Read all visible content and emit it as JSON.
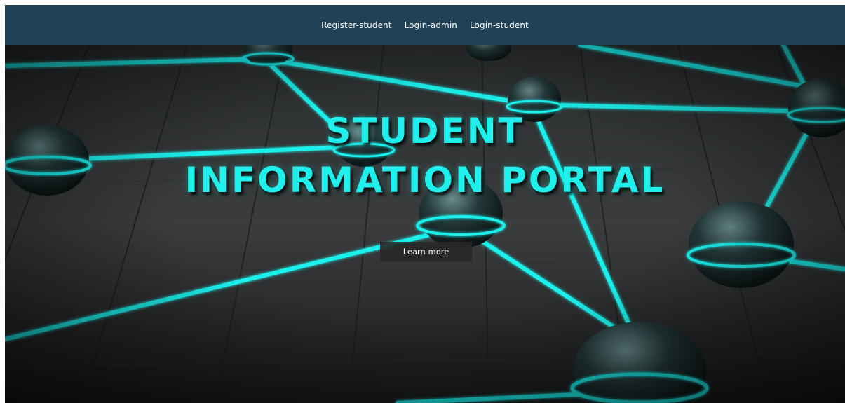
{
  "nav": {
    "items": [
      {
        "label": "Register-student"
      },
      {
        "label": "Login-admin"
      },
      {
        "label": "Login-student"
      }
    ]
  },
  "hero": {
    "title_line_1": "STUDENT",
    "title_line_2": "INFORMATION PORTAL",
    "button_label": "Learn more",
    "background": "network-nodes-illustration"
  },
  "colors": {
    "navbar": "#1f4257",
    "accent_cyan": "#1ff0ec",
    "button_bg": "#282828"
  }
}
